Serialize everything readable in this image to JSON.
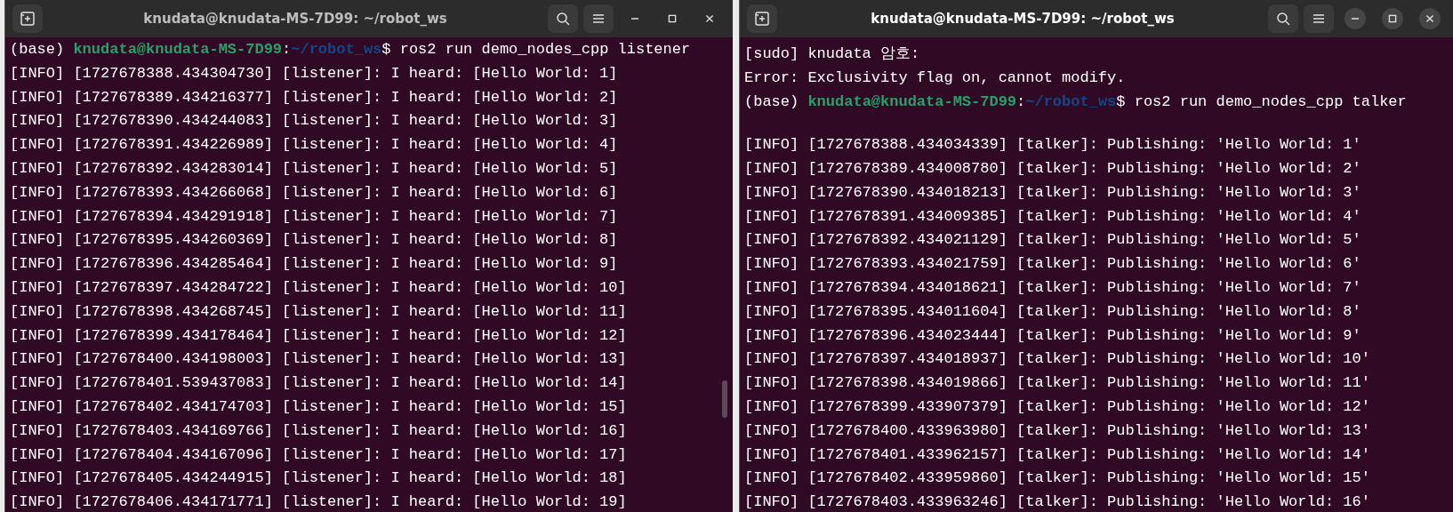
{
  "windows": [
    {
      "title": "knudata@knudata-MS-7D99: ~/robot_ws",
      "focused": false,
      "scrollbar": true,
      "lines": [
        {
          "kind": "prompt",
          "env": "(base)",
          "user_host": "knudata@knudata-MS-7D99",
          "separator": ":",
          "path": "~/robot_ws",
          "command": "$ ros2 run demo_nodes_cpp listener"
        },
        {
          "kind": "output",
          "text": "[INFO] [1727678388.434304730] [listener]: I heard: [Hello World: 1]"
        },
        {
          "kind": "output",
          "text": "[INFO] [1727678389.434216377] [listener]: I heard: [Hello World: 2]"
        },
        {
          "kind": "output",
          "text": "[INFO] [1727678390.434244083] [listener]: I heard: [Hello World: 3]"
        },
        {
          "kind": "output",
          "text": "[INFO] [1727678391.434226989] [listener]: I heard: [Hello World: 4]"
        },
        {
          "kind": "output",
          "text": "[INFO] [1727678392.434283014] [listener]: I heard: [Hello World: 5]"
        },
        {
          "kind": "output",
          "text": "[INFO] [1727678393.434266068] [listener]: I heard: [Hello World: 6]"
        },
        {
          "kind": "output",
          "text": "[INFO] [1727678394.434291918] [listener]: I heard: [Hello World: 7]"
        },
        {
          "kind": "output",
          "text": "[INFO] [1727678395.434260369] [listener]: I heard: [Hello World: 8]"
        },
        {
          "kind": "output",
          "text": "[INFO] [1727678396.434285464] [listener]: I heard: [Hello World: 9]"
        },
        {
          "kind": "output",
          "text": "[INFO] [1727678397.434284722] [listener]: I heard: [Hello World: 10]"
        },
        {
          "kind": "output",
          "text": "[INFO] [1727678398.434268745] [listener]: I heard: [Hello World: 11]"
        },
        {
          "kind": "output",
          "text": "[INFO] [1727678399.434178464] [listener]: I heard: [Hello World: 12]"
        },
        {
          "kind": "output",
          "text": "[INFO] [1727678400.434198003] [listener]: I heard: [Hello World: 13]"
        },
        {
          "kind": "output",
          "text": "[INFO] [1727678401.539437083] [listener]: I heard: [Hello World: 14]"
        },
        {
          "kind": "output",
          "text": "[INFO] [1727678402.434174703] [listener]: I heard: [Hello World: 15]"
        },
        {
          "kind": "output",
          "text": "[INFO] [1727678403.434169766] [listener]: I heard: [Hello World: 16]"
        },
        {
          "kind": "output",
          "text": "[INFO] [1727678404.434167096] [listener]: I heard: [Hello World: 17]"
        },
        {
          "kind": "output",
          "text": "[INFO] [1727678405.434244915] [listener]: I heard: [Hello World: 18]"
        },
        {
          "kind": "output",
          "text": "[INFO] [1727678406.434171771] [listener]: I heard: [Hello World: 19]"
        }
      ]
    },
    {
      "title": "knudata@knudata-MS-7D99: ~/robot_ws",
      "focused": true,
      "scrollbar": false,
      "lines": [
        {
          "kind": "output",
          "text": "[sudo] knudata 암호:"
        },
        {
          "kind": "output",
          "text": "Error: Exclusivity flag on, cannot modify."
        },
        {
          "kind": "prompt",
          "env": "(base)",
          "user_host": "knudata@knudata-MS-7D99",
          "separator": ":",
          "path": "~/robot_ws",
          "command": "$ ros2 run demo_nodes_cpp talker"
        },
        {
          "kind": "blank"
        },
        {
          "kind": "output",
          "text": "[INFO] [1727678388.434034339] [talker]: Publishing: 'Hello World: 1'"
        },
        {
          "kind": "output",
          "text": "[INFO] [1727678389.434008780] [talker]: Publishing: 'Hello World: 2'"
        },
        {
          "kind": "output",
          "text": "[INFO] [1727678390.434018213] [talker]: Publishing: 'Hello World: 3'"
        },
        {
          "kind": "output",
          "text": "[INFO] [1727678391.434009385] [talker]: Publishing: 'Hello World: 4'"
        },
        {
          "kind": "output",
          "text": "[INFO] [1727678392.434021129] [talker]: Publishing: 'Hello World: 5'"
        },
        {
          "kind": "output",
          "text": "[INFO] [1727678393.434021759] [talker]: Publishing: 'Hello World: 6'"
        },
        {
          "kind": "output",
          "text": "[INFO] [1727678394.434018621] [talker]: Publishing: 'Hello World: 7'"
        },
        {
          "kind": "output",
          "text": "[INFO] [1727678395.434011604] [talker]: Publishing: 'Hello World: 8'"
        },
        {
          "kind": "output",
          "text": "[INFO] [1727678396.434023444] [talker]: Publishing: 'Hello World: 9'"
        },
        {
          "kind": "output",
          "text": "[INFO] [1727678397.434018937] [talker]: Publishing: 'Hello World: 10'"
        },
        {
          "kind": "output",
          "text": "[INFO] [1727678398.434019866] [talker]: Publishing: 'Hello World: 11'"
        },
        {
          "kind": "output",
          "text": "[INFO] [1727678399.433907379] [talker]: Publishing: 'Hello World: 12'"
        },
        {
          "kind": "output",
          "text": "[INFO] [1727678400.433963980] [talker]: Publishing: 'Hello World: 13'"
        },
        {
          "kind": "output",
          "text": "[INFO] [1727678401.433962157] [talker]: Publishing: 'Hello World: 14'"
        },
        {
          "kind": "output",
          "text": "[INFO] [1727678402.433959860] [talker]: Publishing: 'Hello World: 15'"
        },
        {
          "kind": "output",
          "text": "[INFO] [1727678403.433963246] [talker]: Publishing: 'Hello World: 16'"
        }
      ]
    }
  ]
}
